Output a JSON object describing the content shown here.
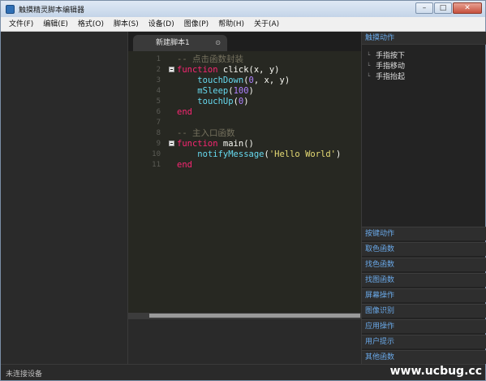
{
  "window": {
    "title": "触摸精灵脚本编辑器",
    "controls": [
      "–",
      "□",
      "✕"
    ]
  },
  "menu": [
    "文件(F)",
    "编辑(E)",
    "格式(O)",
    "脚本(S)",
    "设备(D)",
    "图像(P)",
    "帮助(H)",
    "关于(A)"
  ],
  "editor": {
    "tab_label": "新建脚本1",
    "tab_close": "⊙",
    "line_numbers": [
      "1",
      "2",
      "3",
      "4",
      "5",
      "6",
      "7",
      "8",
      "9",
      "10",
      "11"
    ],
    "lines": [
      "-- 点击函数封装",
      "function click(x, y)",
      "    touchDown(0, x, y)",
      "    mSleep(100)",
      "    touchUp(0)",
      "end",
      "",
      "-- 主入口函数",
      "function main()",
      "    notifyMessage('Hello World')",
      "end"
    ]
  },
  "right_panel": {
    "header": "触摸动作",
    "items": [
      "手指按下",
      "手指移动",
      "手指抬起"
    ],
    "sections": [
      "按键动作",
      "取色函数",
      "找色函数",
      "找图函数",
      "屏幕操作",
      "图像识别",
      "应用操作",
      "用户提示",
      "其他函数"
    ]
  },
  "status": {
    "text": "未连接设备",
    "watermark": "www.ucbug.cc"
  },
  "colors": {
    "keyword": "#f92672",
    "function": "#66d9ef",
    "number": "#ae81ff",
    "string": "#e6db74",
    "comment": "#75715e",
    "panel_link": "#6aa9e9"
  }
}
